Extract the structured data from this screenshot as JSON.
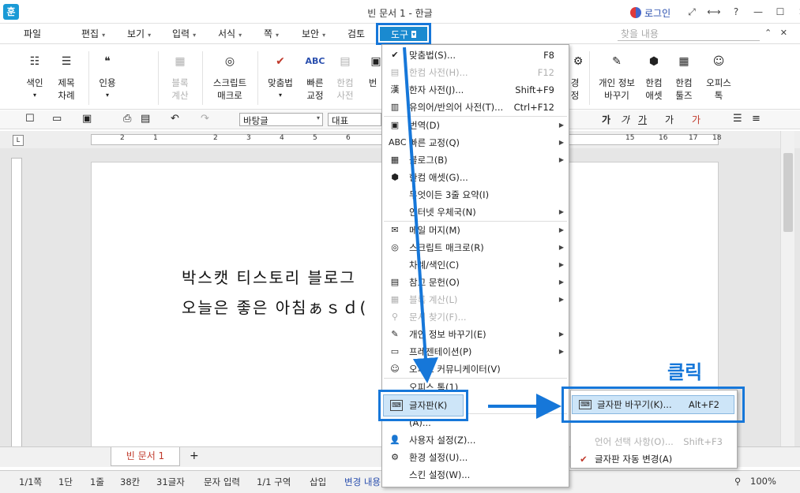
{
  "titlebar": {
    "logo": "훈",
    "title": "빈 문서 1 - 한글",
    "login": "로그인",
    "icon_expand": "⤢",
    "icon_split": "⟷",
    "icon_help": "?",
    "icon_min": "—",
    "icon_max": "☐",
    "icon_close": "✕"
  },
  "menubar": {
    "items": [
      "파일",
      "편집",
      "보기",
      "입력",
      "서식",
      "쪽",
      "보안",
      "검토"
    ],
    "tools": "도구",
    "find_placeholder": "찾을 내용",
    "find_up": "⌃",
    "find_close": "✕"
  },
  "ribbon": {
    "items": [
      {
        "l1": "색인",
        "l2": "",
        "icon": "☷"
      },
      {
        "l1": "제목",
        "l2": "차례",
        "icon": "☰"
      },
      {
        "l1": "인용",
        "l2": "",
        "icon": "❝"
      },
      {
        "l1": "블록",
        "l2": "계산",
        "icon": "▦"
      },
      {
        "l1": "스크립트",
        "l2": "매크로",
        "icon": "◎"
      },
      {
        "l1": "맞춤법",
        "l2": "",
        "icon": "✔"
      },
      {
        "l1": "빠른",
        "l2": "교정",
        "icon": "ABC"
      },
      {
        "l1": "한컴",
        "l2": "사전",
        "icon": "▤"
      },
      {
        "l1": "번",
        "l2": "",
        "icon": "▣"
      },
      {
        "l1": "경",
        "l2": "정",
        "icon": "⚙"
      },
      {
        "l1": "개인 정보",
        "l2": "바꾸기",
        "icon": "✎"
      },
      {
        "l1": "한컴",
        "l2": "애셋",
        "icon": "⬢"
      },
      {
        "l1": "한컴",
        "l2": "툴즈",
        "icon": "▦"
      },
      {
        "l1": "오피스",
        "l2": "톡",
        "icon": "☺"
      }
    ]
  },
  "fmtbar": {
    "style": "바탕글",
    "font": "대표",
    "bold": "가",
    "italic": "가",
    "underline": "가",
    "strike": "가",
    "color": "가"
  },
  "ruler": {
    "corner": "L",
    "numbers": [
      "2",
      "1",
      "2",
      "3",
      "4",
      "5",
      "6",
      "7",
      "8",
      "9",
      "10",
      "11",
      "12",
      "13",
      "14",
      "15",
      "16",
      "17",
      "18"
    ]
  },
  "document": {
    "line1": "박스캣 티스토리 블로그",
    "line2": "오늘은 좋은 아침ぁｓｄ("
  },
  "tabbar": {
    "tab": "빈 문서 1",
    "add": "+"
  },
  "statusbar": {
    "page": "1/1쪽",
    "col": "1단",
    "line": "1줄",
    "kan": "38칸",
    "chars": "31글자",
    "mode": "문자 입력",
    "section": "1/1 구역",
    "insert": "삽입",
    "track": "변경 내용",
    "zoom": "100%"
  },
  "dropdown": {
    "items": [
      {
        "icon": "✔",
        "label": "맞춤법(S)...",
        "shortcut": "F8",
        "disabled": false,
        "sub": false
      },
      {
        "icon": "▤",
        "label": "한컴 사전(H)...",
        "shortcut": "F12",
        "disabled": true,
        "sub": false
      },
      {
        "icon": "漢",
        "label": "한자 사전(J)...",
        "shortcut": "Shift+F9",
        "disabled": false,
        "sub": false
      },
      {
        "icon": "▥",
        "label": "유의어/반의어 사전(T)...",
        "shortcut": "Ctrl+F12",
        "disabled": false,
        "sub": false
      },
      {
        "icon": "▣",
        "label": "번역(D)",
        "shortcut": "",
        "disabled": false,
        "sub": true
      },
      {
        "icon": "ABC",
        "label": "빠른 교정(Q)",
        "shortcut": "",
        "disabled": false,
        "sub": true
      },
      {
        "icon": "▦",
        "label": "블로그(B)",
        "shortcut": "",
        "disabled": false,
        "sub": true
      },
      {
        "icon": "⬢",
        "label": "한컴 애셋(G)...",
        "shortcut": "",
        "disabled": false,
        "sub": false
      },
      {
        "icon": "",
        "label": "무엇이든 3줄 요약(I)",
        "shortcut": "",
        "disabled": false,
        "sub": false
      },
      {
        "icon": "",
        "label": "인터넷 우체국(N)",
        "shortcut": "",
        "disabled": false,
        "sub": true
      },
      {
        "icon": "✉",
        "label": "메일 머지(M)",
        "shortcut": "",
        "disabled": false,
        "sub": true
      },
      {
        "icon": "◎",
        "label": "스크립트 매크로(R)",
        "shortcut": "",
        "disabled": false,
        "sub": true
      },
      {
        "icon": "",
        "label": "차례/색인(C)",
        "shortcut": "",
        "disabled": false,
        "sub": true
      },
      {
        "icon": "▤",
        "label": "참고 문헌(O)",
        "shortcut": "",
        "disabled": false,
        "sub": true
      },
      {
        "icon": "▦",
        "label": "블록 계산(L)",
        "shortcut": "",
        "disabled": true,
        "sub": true
      },
      {
        "icon": "⚲",
        "label": "문서 찾기(F)...",
        "shortcut": "",
        "disabled": true,
        "sub": false
      },
      {
        "icon": "✎",
        "label": "개인 정보 바꾸기(E)",
        "shortcut": "",
        "disabled": false,
        "sub": true
      },
      {
        "icon": "▭",
        "label": "프레젠테이션(P)",
        "shortcut": "",
        "disabled": false,
        "sub": true
      },
      {
        "icon": "☺",
        "label": "오피스 커뮤니케이터(V)",
        "shortcut": "",
        "disabled": false,
        "sub": false
      },
      {
        "icon": "",
        "label": "오피스 톡(1)",
        "shortcut": "",
        "disabled": false,
        "sub": false
      },
      {
        "icon": "",
        "label": "",
        "shortcut": "",
        "disabled": false,
        "sub": false
      },
      {
        "icon": "",
        "label": "(A)...",
        "shortcut": "",
        "disabled": false,
        "sub": false
      },
      {
        "icon": "👤",
        "label": "사용자 설정(Z)...",
        "shortcut": "",
        "disabled": false,
        "sub": false
      },
      {
        "icon": "⚙",
        "label": "환경 설정(U)...",
        "shortcut": "",
        "disabled": false,
        "sub": false
      },
      {
        "icon": "",
        "label": "스킨 설정(W)...",
        "shortcut": "",
        "disabled": false,
        "sub": false
      }
    ],
    "glyph_item": {
      "icon": "⌨",
      "label": "글자판(K)"
    }
  },
  "submenu": {
    "highlight": {
      "icon": "⌨",
      "label": "글자판 바꾸기(K)...",
      "shortcut": "Alt+F2"
    },
    "items": [
      {
        "label": "언어 선택 사항(O)...",
        "shortcut": "Shift+F3",
        "disabled": true,
        "check": false
      },
      {
        "label": "글자판 자동 변경(A)",
        "shortcut": "",
        "disabled": false,
        "check": true
      }
    ]
  },
  "annotation": {
    "click": "클릭"
  },
  "colors": {
    "accent": "#1677d9",
    "highlight": "#cde5f8",
    "tool_menu": "#1a8ad0"
  }
}
